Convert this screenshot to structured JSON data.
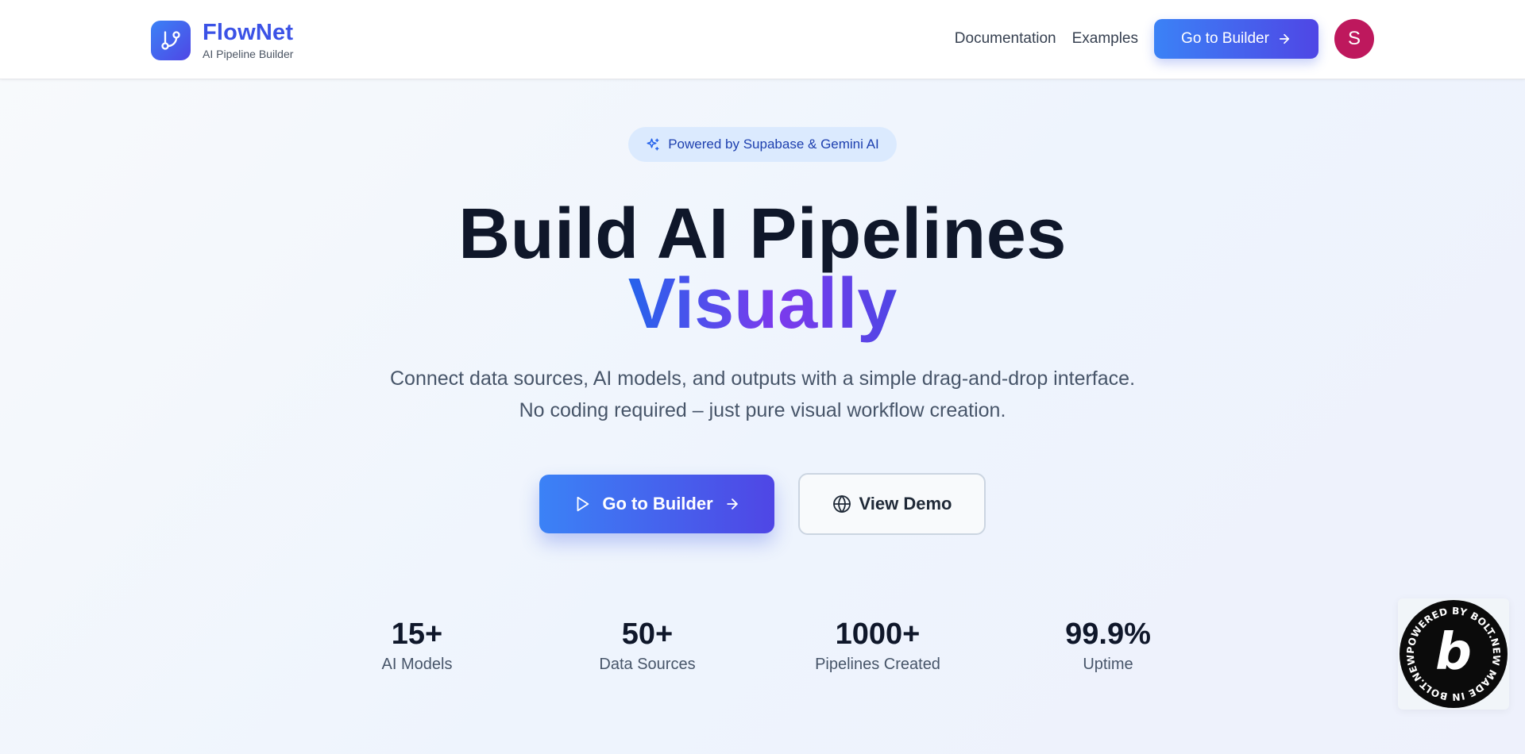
{
  "header": {
    "brand_name": "FlowNet",
    "brand_subtitle": "AI Pipeline Builder",
    "nav_links": [
      "Documentation",
      "Examples"
    ],
    "cta_label": "Go to Builder",
    "avatar_initial": "S"
  },
  "hero": {
    "badge_text": "Powered by Supabase & Gemini AI",
    "title_line1": "Build AI Pipelines",
    "title_line2": "Visually",
    "description_line1": "Connect data sources, AI models, and outputs with a simple drag-and-drop interface.",
    "description_line2": "No coding required – just pure visual workflow creation.",
    "primary_button": "Go to Builder",
    "secondary_button": "View Demo"
  },
  "stats": [
    {
      "value": "15+",
      "label": "AI Models"
    },
    {
      "value": "50+",
      "label": "Data Sources"
    },
    {
      "value": "1000+",
      "label": "Pipelines Created"
    },
    {
      "value": "99.9%",
      "label": "Uptime"
    }
  ],
  "bolt_badge": {
    "ring_text": "POWERED BY BOLT.NEW MADE IN BOLT.NEW ",
    "letter": "b"
  },
  "colors": {
    "accent": "#3b82f6",
    "accent_end": "#4f46e5",
    "avatar": "#be185d",
    "badge_bg": "#dbeafe"
  },
  "icons": [
    "git-branch-icon",
    "arrow-right-icon",
    "sparkles-icon",
    "play-icon",
    "globe-icon",
    "bolt-logo-icon"
  ]
}
